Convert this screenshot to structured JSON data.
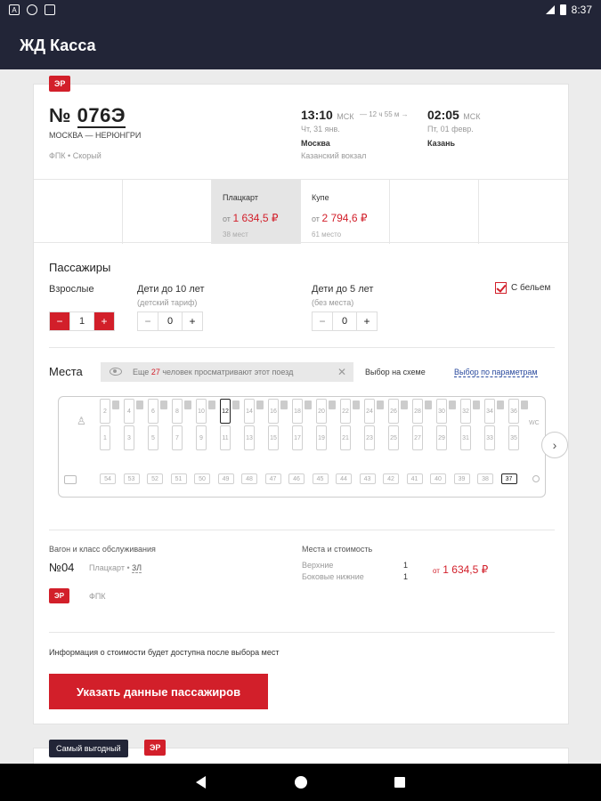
{
  "status": {
    "time": "8:37"
  },
  "appbar": {
    "title": "ЖД Касса"
  },
  "train": {
    "badge": "ЭР",
    "number_prefix": "№",
    "number": "076Э",
    "route": "МОСКВА — НЕРЮНГРИ",
    "carrier": "ФПК • Скорый",
    "depart_time": "13:10",
    "depart_tz": "МСК",
    "depart_date": "Чт, 31 янв.",
    "depart_city": "Москва",
    "depart_station": "Казанский вокзал",
    "duration": "12 ч 55 м",
    "arrive_time": "02:05",
    "arrive_tz": "МСК",
    "arrive_date": "Пт, 01 февр.",
    "arrive_city": "Казань"
  },
  "classes": [
    {
      "name": "",
      "price": "",
      "seats": ""
    },
    {
      "name": "",
      "price": "",
      "seats": ""
    },
    {
      "name": "Плацкарт",
      "prefix": "от",
      "price": "1 634,5 ₽",
      "seats": "38 мест"
    },
    {
      "name": "Купе",
      "prefix": "от",
      "price": "2 794,6 ₽",
      "seats": "61 место"
    },
    {
      "name": "",
      "price": "",
      "seats": ""
    },
    {
      "name": "",
      "price": "",
      "seats": ""
    }
  ],
  "passengers": {
    "title": "Пассажиры",
    "adults_label": "Взрослые",
    "adults_value": "1",
    "kids10_label": "Дети до 10 лет",
    "kids10_sub": "(детский тариф)",
    "kids10_value": "0",
    "kids5_label": "Дети до 5 лет",
    "kids5_sub": "(без места)",
    "kids5_value": "0",
    "linen_label": "С бельем"
  },
  "seats": {
    "title": "Места",
    "viewers_prefix": "Еще",
    "viewers_count": "27",
    "viewers_suffix": "человек просматривают этот поезд",
    "scheme_option": "Выбор на схеме",
    "params_option": "Выбор по параметрам",
    "upper": [
      "2",
      "4",
      "6",
      "8",
      "10",
      "12",
      "14",
      "16",
      "18",
      "20",
      "22",
      "24",
      "26",
      "28",
      "30",
      "32",
      "34",
      "36"
    ],
    "lower": [
      "1",
      "3",
      "5",
      "7",
      "9",
      "11",
      "13",
      "15",
      "17",
      "19",
      "21",
      "23",
      "25",
      "27",
      "29",
      "31",
      "33",
      "35"
    ],
    "side": [
      "54",
      "53",
      "52",
      "51",
      "50",
      "49",
      "48",
      "47",
      "46",
      "45",
      "44",
      "43",
      "42",
      "41",
      "40",
      "39",
      "38",
      "37"
    ],
    "available_upper": [
      "12"
    ],
    "available_side": [
      "37"
    ],
    "wc": "WC"
  },
  "selection": {
    "wagon_title": "Вагон и класс обслуживания",
    "wagon_no": "№04",
    "wagon_class": "Плацкарт",
    "wagon_sub": "3Л",
    "badge": "ЭР",
    "carrier": "ФПК",
    "places_title": "Места и стоимость",
    "upper_label": "Верхние",
    "upper_count": "1",
    "side_label": "Боковые нижние",
    "side_count": "1",
    "price_prefix": "от",
    "price": "1 634,5 ₽"
  },
  "info_text": "Информация о стоимости будет доступна после выбора мест",
  "cta_label": "Указать данные пассажиров",
  "next_card": {
    "best_badge": "Самый выгодный",
    "badge": "ЭР"
  },
  "colors": {
    "accent": "#d21f2a",
    "dark": "#222537"
  }
}
